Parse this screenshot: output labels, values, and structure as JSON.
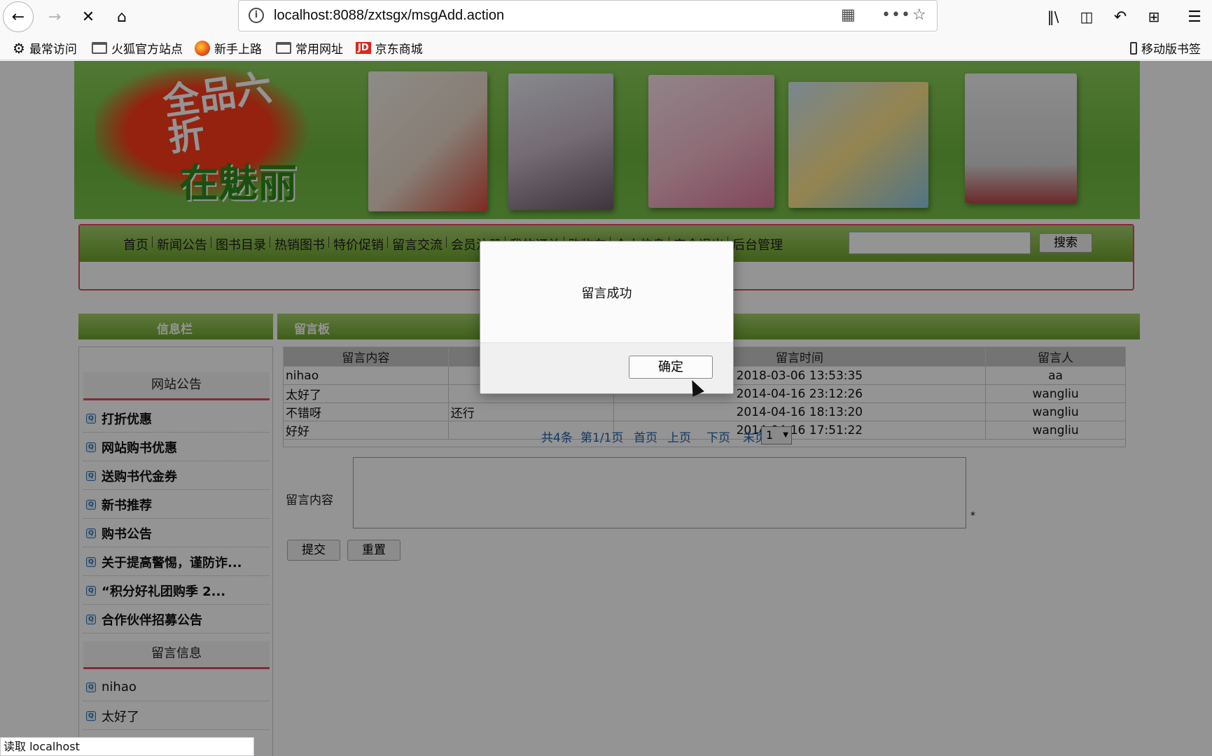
{
  "browser": {
    "url": "localhost:8088/zxtsgx/msgAdd.action",
    "mobile_bookmarks": "移动版书签",
    "bookmarks": [
      "最常访问",
      "火狐官方站点",
      "新手上路",
      "常用网址",
      "京东商城"
    ],
    "status": "读取 localhost"
  },
  "banner": {
    "splash_line1": "全品六折",
    "splash_line2": "在魅丽"
  },
  "nav": {
    "items": [
      "首页",
      "新闻公告",
      "图书目录",
      "热销图书",
      "特价促销",
      "留言交流",
      "会员注册",
      "我的订单",
      "购物车",
      "个人信息",
      "安全退出",
      "后台管理"
    ],
    "search_label": "搜索"
  },
  "sidebar": {
    "title": "信息栏",
    "notice_head": "网站公告",
    "notices": [
      "打折优惠",
      "网站购书优惠",
      "送购书代金券",
      "新书推荐",
      "购书公告",
      "关于提高警惕，谨防诈...",
      "“积分好礼团购季 2...",
      "合作伙伴招募公告"
    ],
    "msg_head": "留言信息",
    "messages": [
      "nihao",
      "太好了"
    ]
  },
  "main": {
    "title": "留言板",
    "columns": [
      "留言内容",
      "回复内容",
      "留言时间",
      "留言人"
    ],
    "rows": [
      {
        "content": "nihao",
        "reply": "",
        "time": "2018-03-06 13:53:35",
        "user": "aa"
      },
      {
        "content": "太好了",
        "reply": "",
        "time": "2014-04-16 23:12:26",
        "user": "wangliu"
      },
      {
        "content": "不错呀",
        "reply": "还行",
        "time": "2014-04-16 18:13:20",
        "user": "wangliu"
      },
      {
        "content": "好好",
        "reply": "",
        "time": "2014-04-16 17:51:22",
        "user": "wangliu"
      }
    ],
    "pager": {
      "total": "共4条",
      "page": "第1/1页",
      "first": "首页",
      "prev": "上页",
      "next": "下页",
      "last": "末页",
      "select": "1"
    },
    "form": {
      "label": "留言内容",
      "required": "*",
      "submit": "提交",
      "reset": "重置"
    }
  },
  "dialog": {
    "message": "留言成功",
    "ok": "确定"
  }
}
